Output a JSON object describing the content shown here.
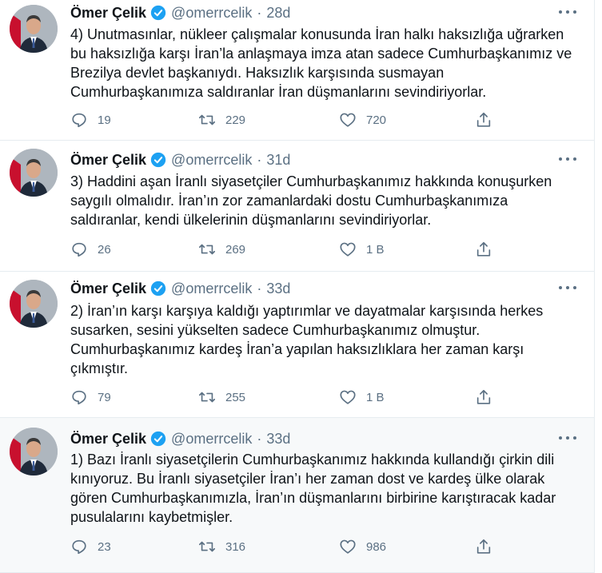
{
  "tweets": [
    {
      "name": "Ömer Çelik",
      "handle": "@omerrcelik",
      "time": "28d",
      "lines": [
        "4) Unutmasınlar, nükleer çalışmalar konusunda İran halkı haksızlığa uğrarken",
        "bu haksızlığa karşı İran’la anlaşmaya imza atan sadece Cumhurbaşkanımız ve",
        "Brezilya devlet başkanıydı. Haksızlık karşısında susmayan",
        "Cumhurbaşkanımıza saldıranlar İran düşmanlarını sevindiriyorlar."
      ],
      "replies": "19",
      "retweets": "229",
      "likes": "720"
    },
    {
      "name": "Ömer Çelik",
      "handle": "@omerrcelik",
      "time": "31d",
      "lines": [
        "3) Haddini aşan İranlı siyasetçiler Cumhurbaşkanımız hakkında konuşurken",
        "saygılı olmalıdır. İran’ın zor zamanlardaki dostu Cumhurbaşkanımıza",
        "saldıranlar, kendi ülkelerinin düşmanlarını sevindiriyorlar."
      ],
      "replies": "26",
      "retweets": "269",
      "likes": "1 B"
    },
    {
      "name": "Ömer Çelik",
      "handle": "@omerrcelik",
      "time": "33d",
      "lines": [
        "2) İran’ın karşı karşıya kaldığı yaptırımlar ve dayatmalar karşısında herkes",
        "susarken, sesini yükselten sadece Cumhurbaşkanımız olmuştur.",
        "Cumhurbaşkanımız kardeş İran’a yapılan haksızlıklara her zaman karşı",
        "çıkmıştır."
      ],
      "replies": "79",
      "retweets": "255",
      "likes": "1 B"
    },
    {
      "name": "Ömer Çelik",
      "handle": "@omerrcelik",
      "time": "33d",
      "lines": [
        "1) Bazı İranlı siyasetçilerin Cumhurbaşkanımız hakkında kullandığı çirkin dili",
        "kınıyoruz. Bu İranlı siyasetçiler İran’ı her zaman dost ve kardeş ülke olarak",
        "gören Cumhurbaşkanımızla, İran’ın düşmanlarını birbirine karıştıracak kadar",
        "pusulalarını kaybetmişler."
      ],
      "replies": "23",
      "retweets": "316",
      "likes": "986"
    }
  ],
  "icons": {
    "verified": "verified-badge-icon",
    "more": "more-icon",
    "reply": "reply-icon",
    "retweet": "retweet-icon",
    "like": "heart-icon",
    "share": "share-icon"
  },
  "colors": {
    "verified": "#1da1f2",
    "secondary_text": "#5b7083",
    "highlight_bg": "#f7f9fa"
  }
}
